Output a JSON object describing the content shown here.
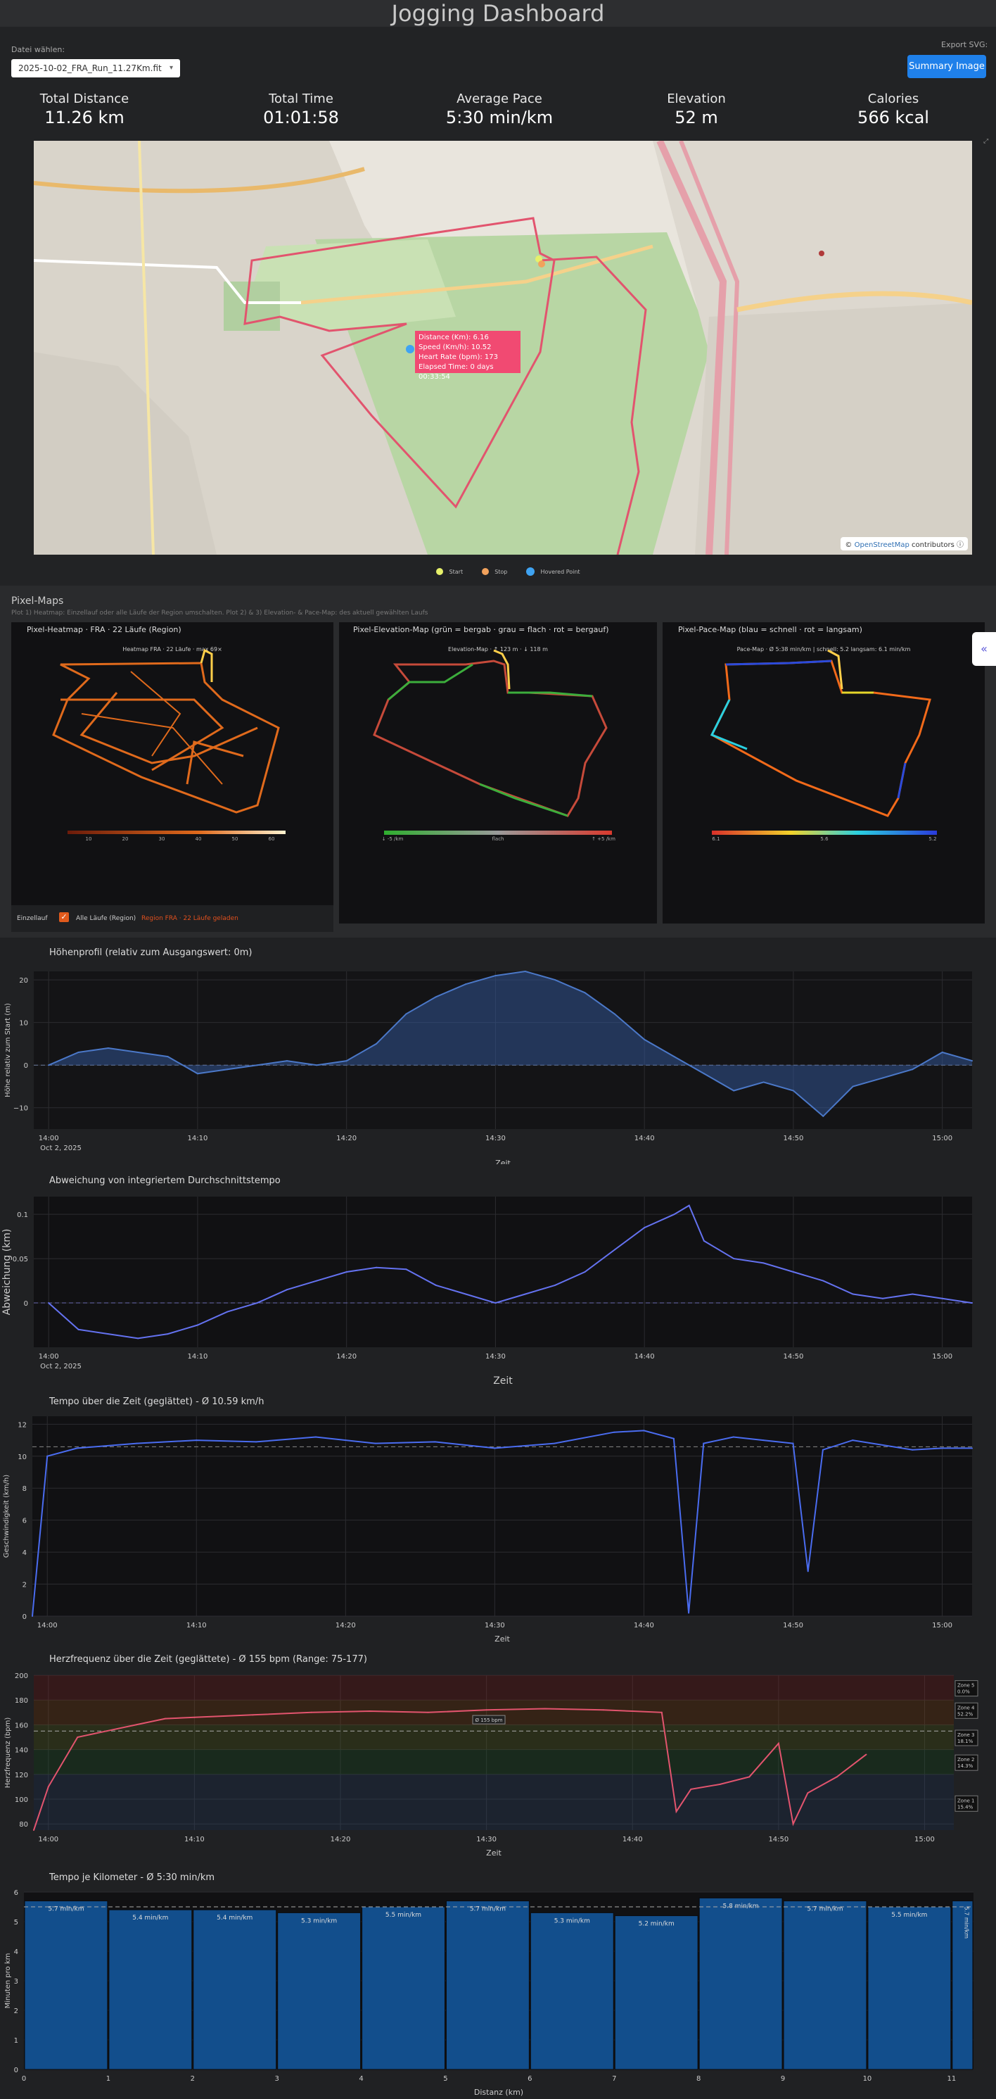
{
  "header": {
    "title": "Jogging Dashboard"
  },
  "file_select": {
    "label": "Datei wählen:",
    "value": "2025-10-02_FRA_Run_11.27Km.fit"
  },
  "export": {
    "label": "Export SVG:",
    "button": "Summary Image"
  },
  "stats": [
    {
      "title": "Total Distance",
      "value": "11.26 km"
    },
    {
      "title": "Total Time",
      "value": "01:01:58"
    },
    {
      "title": "Average Pace",
      "value": "5:30 min/km"
    },
    {
      "title": "Elevation",
      "value": "52 m"
    },
    {
      "title": "Calories",
      "value": "566 kcal"
    }
  ],
  "map": {
    "tooltip": [
      "Distance (Km): 6.16",
      "Speed (Km/h): 10.52",
      "Heart Rate (bpm): 173",
      "Elapsed Time: 0 days 00:33:54"
    ],
    "attribution_prefix": "©",
    "attribution_link": "OpenStreetMap",
    "attribution_suffix": "contributors",
    "legend": [
      "Start",
      "Stop",
      "Hovered Point"
    ],
    "colors": {
      "start": "#e6f06a",
      "stop": "#f2a25c",
      "hover": "#3fa3f2",
      "route": "#e2546e"
    }
  },
  "pixel_maps": {
    "title": "Pixel-Maps",
    "subtitle": "Plot 1) Heatmap: Einzellauf oder alle Läufe der Region umschalten. Plot 2) & 3) Elevation- & Pace-Map: des aktuell gewählten Laufs",
    "heatmap": {
      "title": "Pixel-Heatmap · FRA · 22 Läufe (Region)",
      "inner": "Heatmap FRA · 22 Läufe · max 69×",
      "ticks": [
        "10",
        "20",
        "30",
        "40",
        "50",
        "60"
      ]
    },
    "elevation": {
      "title": "Pixel-Elevation-Map (grün = bergab · grau = flach · rot = bergauf)",
      "inner": "Elevation-Map · ↑ 123 m · ↓ 118 m",
      "ticks": [
        "↓ -5 /km",
        "flach",
        "↑ +5 /km"
      ]
    },
    "pace": {
      "title": "Pixel-Pace-Map (blau = schnell · rot = langsam)",
      "inner": "Pace-Map · Ø 5:38 min/km  |  schnell: 5.2  langsam: 6.1 min/km",
      "ticks": [
        "6.1",
        "5.6",
        "5.2"
      ]
    },
    "controls": {
      "single": "Einzellauf",
      "all": "Alle Läufe (Region)",
      "note": "Region FRA · 22 Läufe geladen"
    },
    "collapse_icon": "double-chevron-left-icon"
  },
  "charts": {
    "elevation": {
      "title": "Höhenprofil (relativ zum Ausgangswert: 0m)",
      "xlabel": "Zeit",
      "ylabel": "Höhe relativ zum Start (m)",
      "xticks": [
        "14:00",
        "14:10",
        "14:20",
        "14:30",
        "14:40",
        "14:50",
        "15:00"
      ],
      "date": "Oct 2, 2025",
      "yticks": [
        "−10",
        "0",
        "10",
        "20"
      ]
    },
    "deviation": {
      "title": "Abweichung von integriertem Durchschnittstempo",
      "xlabel": "Zeit",
      "ylabel": "Abweichung (km)",
      "xticks": [
        "14:00",
        "14:10",
        "14:20",
        "14:30",
        "14:40",
        "14:50",
        "15:00"
      ],
      "date": "Oct 2, 2025",
      "yticks": [
        "0",
        "0.05",
        "0.1"
      ]
    },
    "speed": {
      "title": "Tempo über die Zeit (geglättet) - Ø 10.59 km/h",
      "xlabel": "Zeit",
      "ylabel": "Geschwindigkeit (km/h)",
      "xticks": [
        "14:00",
        "14:10",
        "14:20",
        "14:30",
        "14:40",
        "14:50",
        "15:00"
      ],
      "yticks": [
        "0",
        "2",
        "4",
        "6",
        "8",
        "10",
        "12"
      ]
    },
    "heartrate": {
      "title": "Herzfrequenz über die Zeit (geglättete) - Ø 155 bpm (Range: 75-177)",
      "xlabel": "Zeit",
      "ylabel": "Herzfrequenz (bpm)",
      "xticks": [
        "14:00",
        "14:10",
        "14:20",
        "14:30",
        "14:40",
        "14:50",
        "15:00"
      ],
      "yticks": [
        "80",
        "100",
        "120",
        "140",
        "160",
        "180",
        "200"
      ],
      "avg_label": "Ø 155 bpm",
      "zones": [
        {
          "name": "Zone 5",
          "pct": "0.0%"
        },
        {
          "name": "Zone 4",
          "pct": "52.2%"
        },
        {
          "name": "Zone 3",
          "pct": "18.1%"
        },
        {
          "name": "Zone 2",
          "pct": "14.3%"
        },
        {
          "name": "Zone 1",
          "pct": "15.4%"
        }
      ]
    },
    "pace_km": {
      "title": "Tempo je Kilometer - Ø 5:30 min/km",
      "xlabel": "Distanz (km)",
      "ylabel": "Minuten pro km",
      "xticks": [
        "0",
        "1",
        "2",
        "3",
        "4",
        "5",
        "6",
        "7",
        "8",
        "9",
        "10",
        "11"
      ],
      "yticks": [
        "0",
        "1",
        "2",
        "3",
        "4",
        "5",
        "6"
      ],
      "bar_labels": [
        "5.7 min/km",
        "5.4 min/km",
        "5.4 min/km",
        "5.3 min/km",
        "5.5 min/km",
        "5.7 min/km",
        "5.3 min/km",
        "5.2 min/km",
        "5.8 min/km",
        "5.7 min/km",
        "5.5 min/km",
        "5.7 min/km"
      ]
    }
  },
  "chart_data": [
    {
      "type": "area",
      "x": [
        "14:00",
        "14:02",
        "14:04",
        "14:06",
        "14:08",
        "14:10",
        "14:12",
        "14:14",
        "14:16",
        "14:18",
        "14:20",
        "14:22",
        "14:24",
        "14:26",
        "14:28",
        "14:30",
        "14:32",
        "14:34",
        "14:36",
        "14:38",
        "14:40",
        "14:42",
        "14:44",
        "14:46",
        "14:48",
        "14:50",
        "14:52",
        "14:54",
        "14:56",
        "14:58",
        "15:00",
        "15:02"
      ],
      "values": [
        0,
        3,
        4,
        3,
        2,
        -2,
        -1,
        0,
        1,
        0,
        1,
        5,
        12,
        16,
        19,
        21,
        22,
        20,
        17,
        12,
        6,
        2,
        -2,
        -6,
        -4,
        -6,
        -12,
        -5,
        -3,
        -1,
        3,
        1
      ],
      "ylim": [
        -15,
        22
      ]
    },
    {
      "type": "line",
      "x": [
        "14:00",
        "14:02",
        "14:04",
        "14:06",
        "14:08",
        "14:10",
        "14:12",
        "14:14",
        "14:16",
        "14:18",
        "14:20",
        "14:22",
        "14:24",
        "14:26",
        "14:28",
        "14:30",
        "14:32",
        "14:34",
        "14:36",
        "14:38",
        "14:40",
        "14:42",
        "14:43",
        "14:44",
        "14:46",
        "14:48",
        "14:50",
        "14:52",
        "14:54",
        "14:56",
        "14:58",
        "15:00",
        "15:02"
      ],
      "values": [
        0,
        -0.03,
        -0.035,
        -0.04,
        -0.035,
        -0.025,
        -0.01,
        0.0,
        0.015,
        0.025,
        0.035,
        0.04,
        0.038,
        0.02,
        0.01,
        0.0,
        0.01,
        0.02,
        0.035,
        0.06,
        0.085,
        0.1,
        0.11,
        0.07,
        0.05,
        0.045,
        0.035,
        0.025,
        0.01,
        0.005,
        0.01,
        0.005,
        0.0
      ],
      "ylim": [
        -0.05,
        0.12
      ]
    },
    {
      "type": "line",
      "x": [
        "13:59",
        "14:00",
        "14:02",
        "14:06",
        "14:10",
        "14:14",
        "14:18",
        "14:22",
        "14:26",
        "14:30",
        "14:34",
        "14:38",
        "14:40",
        "14:42",
        "14:43",
        "14:44",
        "14:46",
        "14:48",
        "14:50",
        "14:51",
        "14:52",
        "14:54",
        "14:58",
        "15:00",
        "15:02"
      ],
      "values": [
        0,
        10,
        10.5,
        10.8,
        11,
        10.9,
        11.2,
        10.8,
        10.9,
        10.5,
        10.8,
        11.5,
        11.6,
        11.1,
        0.2,
        10.8,
        11.2,
        11,
        10.8,
        2.8,
        10.4,
        11,
        10.4,
        10.5,
        10.5
      ],
      "ylim": [
        0,
        12.5
      ]
    },
    {
      "type": "line",
      "x": [
        "13:59",
        "14:00",
        "14:02",
        "14:04",
        "14:06",
        "14:08",
        "14:10",
        "14:14",
        "14:18",
        "14:22",
        "14:26",
        "14:30",
        "14:34",
        "14:38",
        "14:40",
        "14:42",
        "14:43",
        "14:44",
        "14:46",
        "14:48",
        "14:50",
        "14:51",
        "14:52",
        "14:54",
        "14:56"
      ],
      "values": [
        75,
        110,
        150,
        155,
        160,
        165,
        166,
        168,
        170,
        171,
        170,
        172,
        173,
        172,
        171,
        170,
        90,
        108,
        112,
        118,
        145,
        80,
        105,
        118,
        136
      ],
      "ylim": [
        75,
        200
      ]
    },
    {
      "type": "bar",
      "categories": [
        "1",
        "2",
        "3",
        "4",
        "5",
        "6",
        "7",
        "8",
        "9",
        "10",
        "11",
        "12"
      ],
      "values": [
        5.7,
        5.4,
        5.4,
        5.3,
        5.5,
        5.7,
        5.3,
        5.2,
        5.8,
        5.7,
        5.5,
        5.7
      ],
      "ylim": [
        0,
        6
      ]
    }
  ]
}
